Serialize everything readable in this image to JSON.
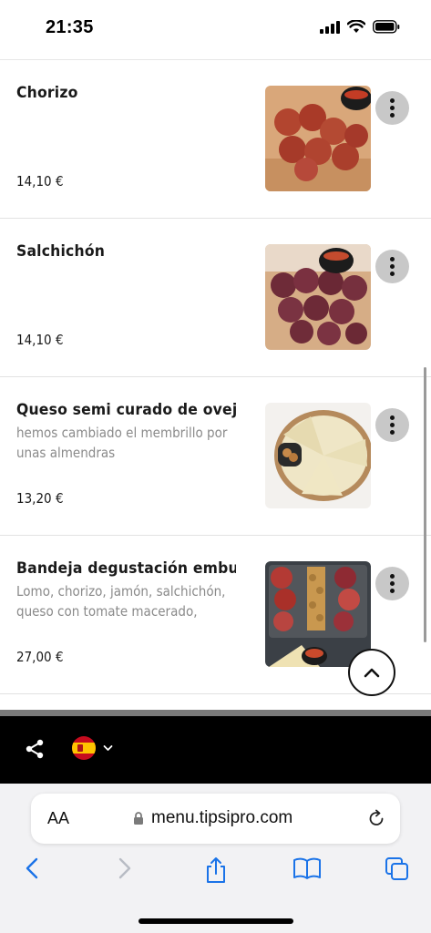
{
  "status_bar": {
    "time": "21:35"
  },
  "menu": {
    "items": [
      {
        "name": "Chorizo",
        "description": "",
        "price": "14,10 €",
        "photo": "chorizo-photo"
      },
      {
        "name": "Salchichón",
        "description": "",
        "price": "14,10 €",
        "photo": "salchichon-photo"
      },
      {
        "name": "Queso semi curado de oveja",
        "description": "hemos cambiado el membrillo por unas almendras",
        "price": "13,20 €",
        "photo": "cheese-photo"
      },
      {
        "name": "Bandeja degustación embutidos",
        "description": "Lomo, chorizo, jamón, salchichón, queso con tomate macerado, almendras y...",
        "price": "27,00 €",
        "photo": "platter-photo"
      }
    ]
  },
  "app_bar": {
    "language": "es",
    "icons": [
      "share-icon",
      "spain-flag-icon",
      "chevron-down-icon"
    ]
  },
  "browser": {
    "text_size_label": "AA",
    "url": "menu.tipsipro.com",
    "toolbar_icons": [
      "back-icon",
      "forward-icon",
      "share-icon",
      "bookmarks-icon",
      "tabs-icon"
    ]
  },
  "colors": {
    "accent": "#1a73e8",
    "app_bar": "#000000",
    "more_button": "#c8c8c8"
  }
}
